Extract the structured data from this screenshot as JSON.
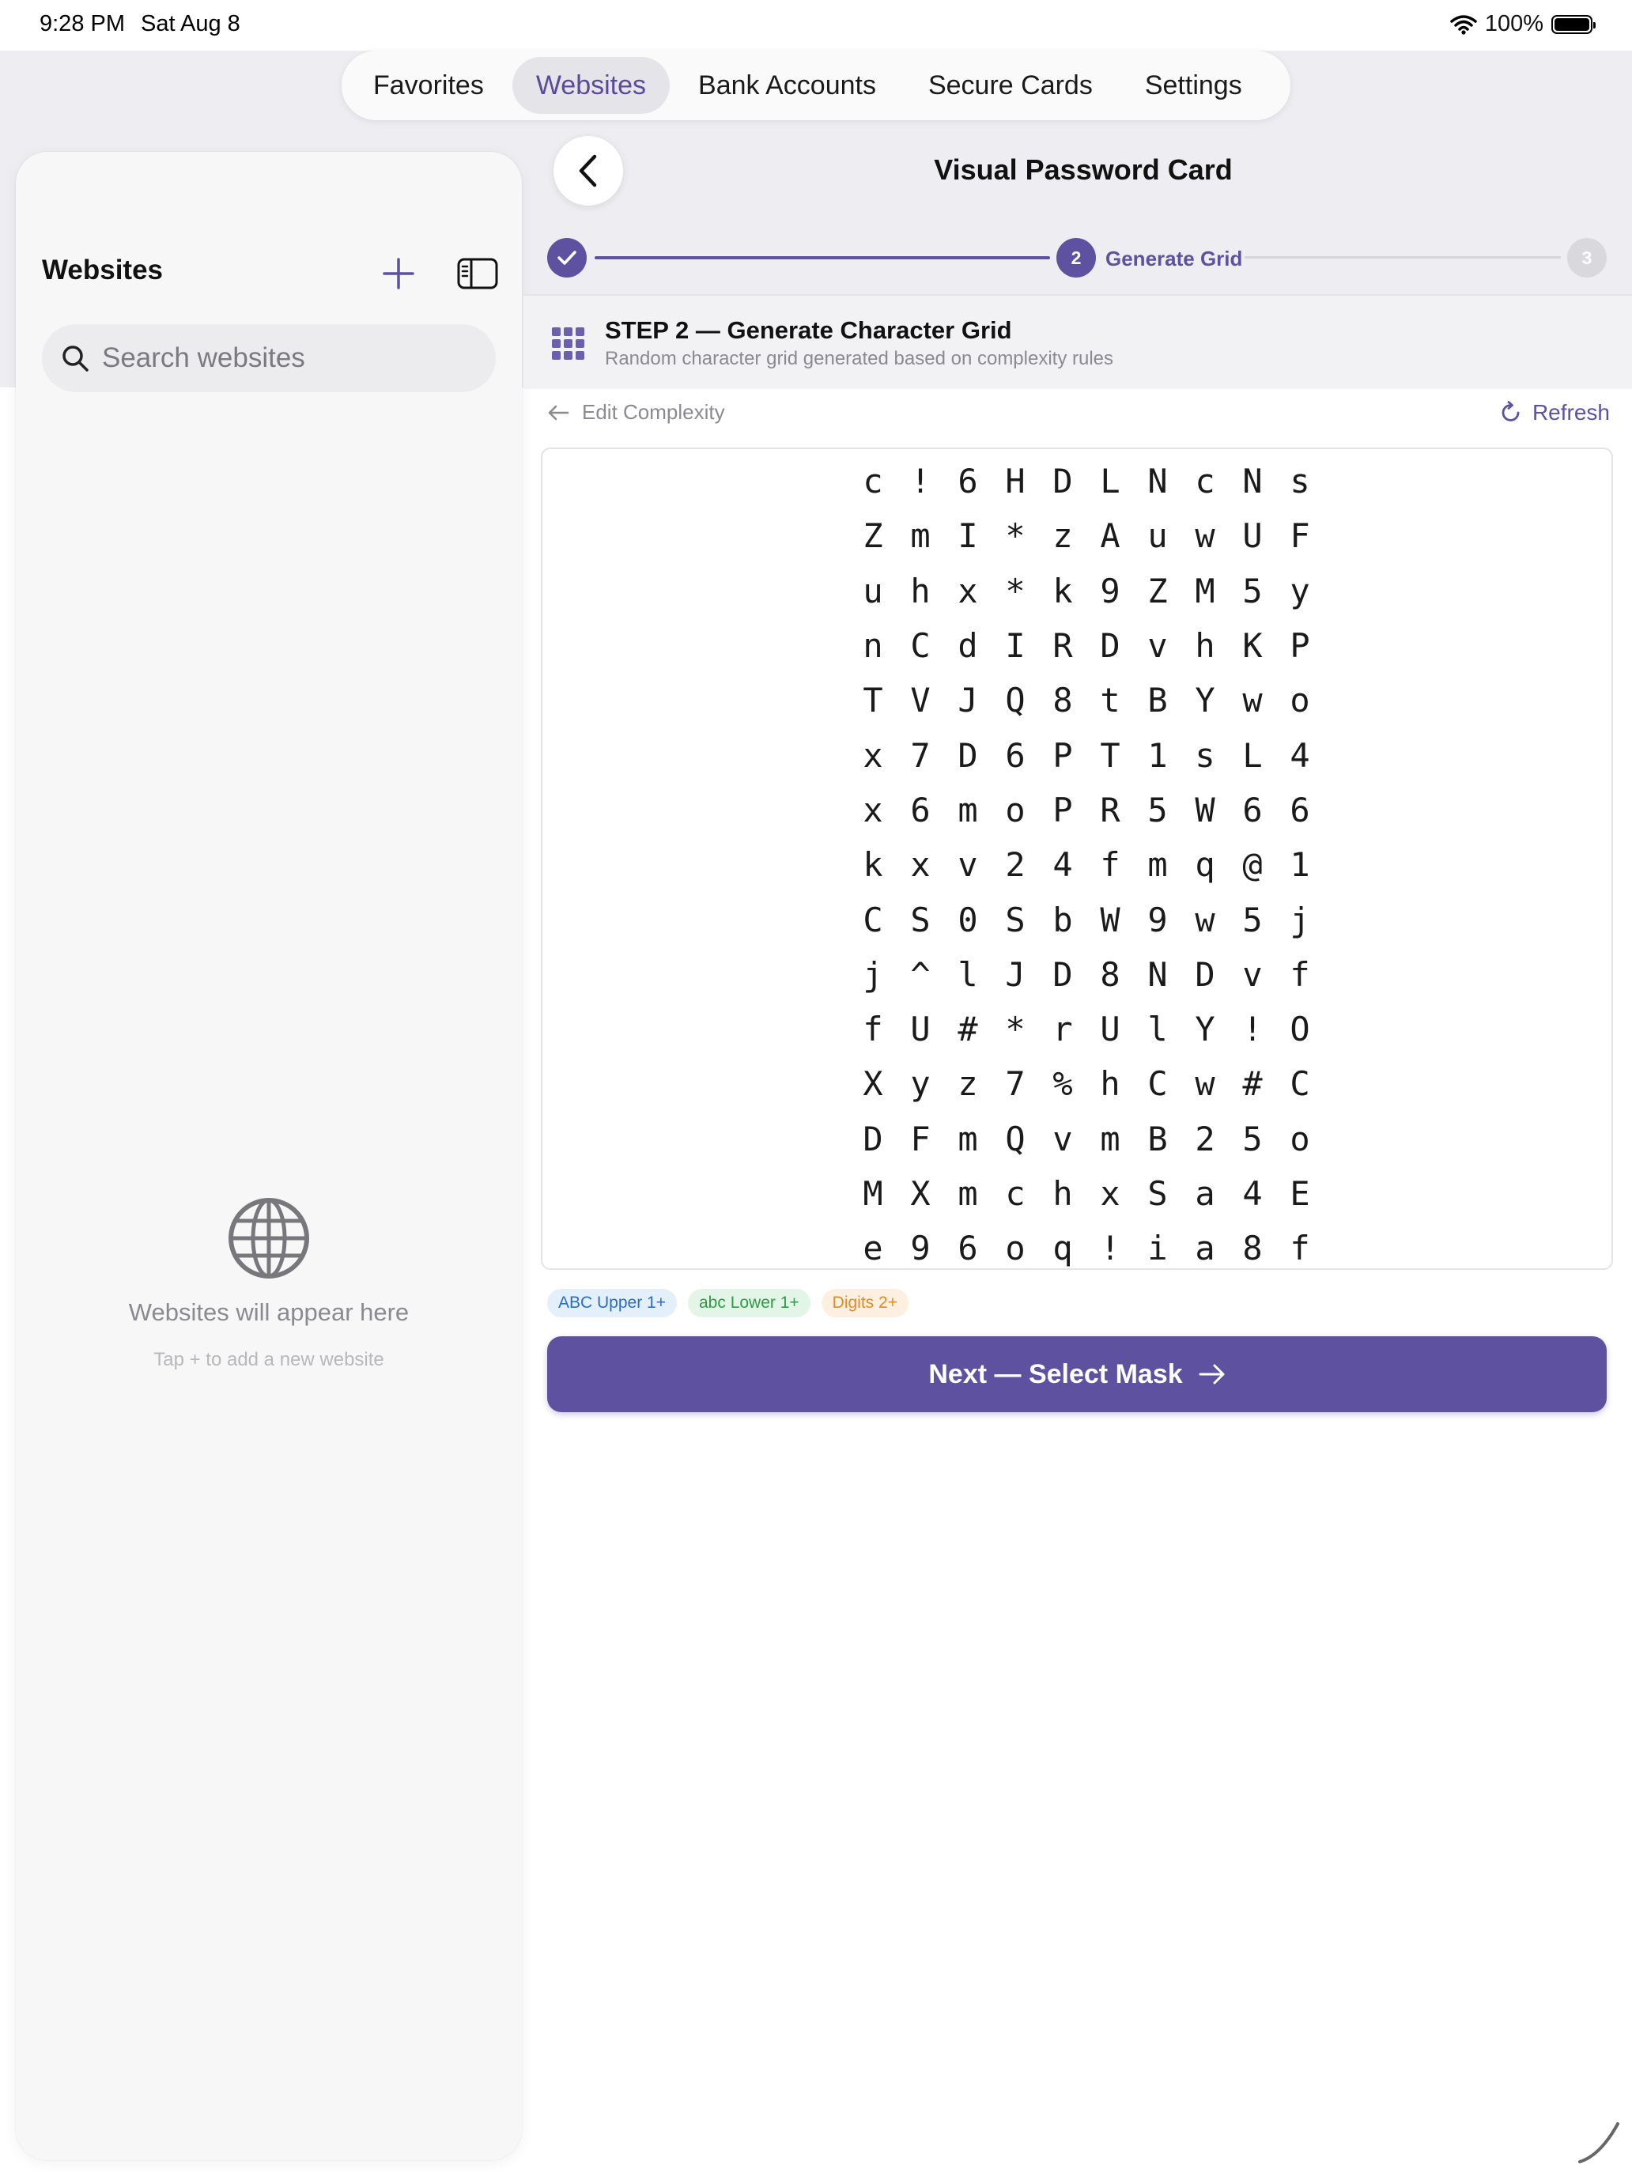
{
  "status_bar": {
    "time": "9:28 PM",
    "date": "Sat Aug 8",
    "battery": "100%"
  },
  "tabs": [
    {
      "label": "Favorites",
      "active": false
    },
    {
      "label": "Websites",
      "active": true
    },
    {
      "label": "Bank Accounts",
      "active": false
    },
    {
      "label": "Secure Cards",
      "active": false
    },
    {
      "label": "Settings",
      "active": false
    }
  ],
  "sidebar": {
    "title": "Websites",
    "search_placeholder": "Search websites",
    "empty_title": "Websites will appear here",
    "empty_subtitle": "Tap + to add a new website",
    "icons": {
      "add": "plus-icon",
      "toggle": "sidebar-toggle-icon",
      "search": "search-icon",
      "empty": "globe-icon"
    }
  },
  "main": {
    "title": "Visual Password Card",
    "stepper": {
      "current_number": "2",
      "current_label": "Generate Grid",
      "next_number": "3"
    },
    "step_header": {
      "title": "STEP 2 — Generate Character Grid",
      "subtitle": "Random character grid generated based on complexity rules"
    },
    "edit_link": "Edit Complexity",
    "refresh_label": "Refresh",
    "grid": [
      [
        "c",
        "!",
        "6",
        "H",
        "D",
        "L",
        "N",
        "c",
        "N",
        "s"
      ],
      [
        "Z",
        "m",
        "I",
        "*",
        "z",
        "A",
        "u",
        "w",
        "U",
        "F"
      ],
      [
        "u",
        "h",
        "x",
        "*",
        "k",
        "9",
        "Z",
        "M",
        "5",
        "y"
      ],
      [
        "n",
        "C",
        "d",
        "I",
        "R",
        "D",
        "v",
        "h",
        "K",
        "P"
      ],
      [
        "T",
        "V",
        "J",
        "Q",
        "8",
        "t",
        "B",
        "Y",
        "w",
        "o"
      ],
      [
        "x",
        "7",
        "D",
        "6",
        "P",
        "T",
        "1",
        "s",
        "L",
        "4"
      ],
      [
        "x",
        "6",
        "m",
        "o",
        "P",
        "R",
        "5",
        "W",
        "6",
        "6"
      ],
      [
        "k",
        "x",
        "v",
        "2",
        "4",
        "f",
        "m",
        "q",
        "@",
        "1"
      ],
      [
        "C",
        "S",
        "0",
        "S",
        "b",
        "W",
        "9",
        "w",
        "5",
        "j"
      ],
      [
        "j",
        "^",
        "l",
        "J",
        "D",
        "8",
        "N",
        "D",
        "v",
        "f"
      ],
      [
        "f",
        "U",
        "#",
        "*",
        "r",
        "U",
        "l",
        "Y",
        "!",
        "O"
      ],
      [
        "X",
        "y",
        "z",
        "7",
        "%",
        "h",
        "C",
        "w",
        "#",
        "C"
      ],
      [
        "D",
        "F",
        "m",
        "Q",
        "v",
        "m",
        "B",
        "2",
        "5",
        "o"
      ],
      [
        "M",
        "X",
        "m",
        "c",
        "h",
        "x",
        "S",
        "a",
        "4",
        "E"
      ],
      [
        "e",
        "9",
        "6",
        "o",
        "q",
        "!",
        "i",
        "a",
        "8",
        "f"
      ]
    ],
    "badges": [
      {
        "label": "ABC Upper 1+",
        "kind": "upper"
      },
      {
        "label": "abc Lower 1+",
        "kind": "lower"
      },
      {
        "label": "Digits 2+",
        "kind": "digits"
      }
    ],
    "next_button": "Next — Select Mask"
  },
  "colors": {
    "accent": "#5e52a0",
    "upper": "#2b6cc4",
    "lower": "#2f9a48",
    "digits": "#e08a2a"
  }
}
